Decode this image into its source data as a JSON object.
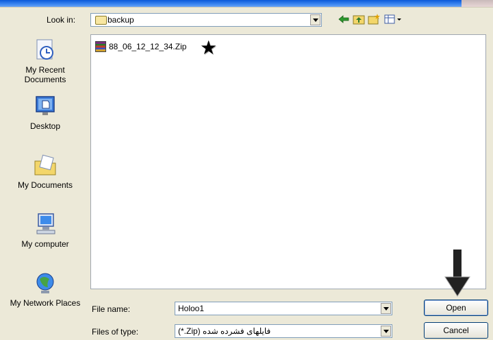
{
  "lookin": {
    "label": "Look in:",
    "folder": "backup"
  },
  "places": [
    {
      "label": "My Recent Documents",
      "icon": "recent-documents-icon"
    },
    {
      "label": "Desktop",
      "icon": "desktop-icon"
    },
    {
      "label": "My Documents",
      "icon": "my-documents-icon"
    },
    {
      "label": "My computer",
      "icon": "my-computer-icon"
    },
    {
      "label": "My Network Places",
      "icon": "network-places-icon"
    }
  ],
  "files": [
    {
      "name": "88_06_12_12_34.Zip",
      "icon": "zip-archive-icon"
    }
  ],
  "filename": {
    "label": "File name:",
    "value": "Holoo1"
  },
  "filetype": {
    "label": "Files of type:",
    "value": "(*.Zip) فایلهای فشرده شده"
  },
  "buttons": {
    "open": "Open",
    "cancel": "Cancel"
  },
  "colors": {
    "titlebar": "#0a58d8",
    "dialog_bg": "#ece9d8",
    "button_border": "#003c74"
  }
}
